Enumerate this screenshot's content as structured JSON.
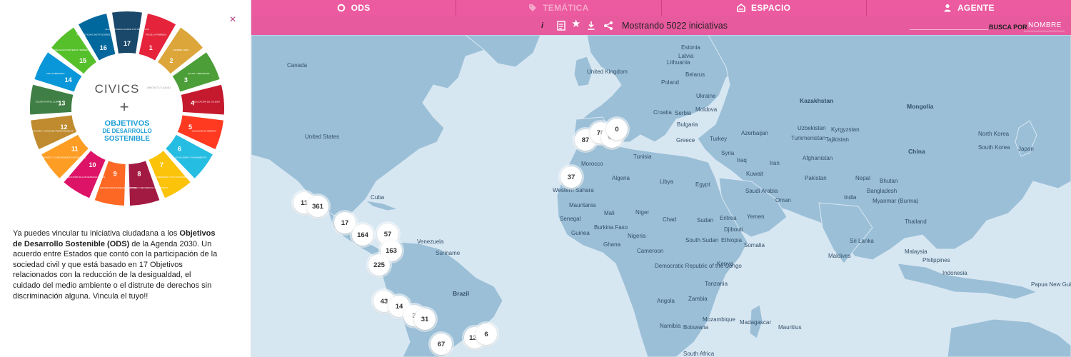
{
  "left_panel": {
    "close_label": "×",
    "wheel": {
      "brand": "CIVICS",
      "tagline": "INNOVA TU CIUDAD",
      "plus": "+",
      "title_line1": "OBJETIVOS",
      "title_line2": "DE DESARROLLO",
      "title_line3": "SOSTENIBLE",
      "colors": [
        "#e5243b",
        "#dda63a",
        "#4c9f38",
        "#c5192d",
        "#ff3a21",
        "#26bde2",
        "#fcc30b",
        "#a21942",
        "#fd6925",
        "#dd1367",
        "#fd9d24",
        "#bf8b2e",
        "#3f7e44",
        "#0a97d9",
        "#56c02b",
        "#00689d",
        "#19486a"
      ],
      "goals": [
        {
          "num": "1",
          "label": "FIN DE LA POBREZA"
        },
        {
          "num": "2",
          "label": "HAMBRE CERO"
        },
        {
          "num": "3",
          "label": "SALUD Y BIENESTAR"
        },
        {
          "num": "4",
          "label": "EDUCACIÓN DE CALIDAD"
        },
        {
          "num": "5",
          "label": "IGUALDAD DE GÉNERO"
        },
        {
          "num": "6",
          "label": "AGUA LIMPIA Y SANEAMIENTO"
        },
        {
          "num": "7",
          "label": "ENERGÍA ASEQUIBLE Y NO CONTAMINANTE"
        },
        {
          "num": "8",
          "label": "TRABAJO DECENTE Y CRECIMIENTO ECONÓMICO"
        },
        {
          "num": "9",
          "label": "INDUSTRIA, INNOVACIÓN E INFRAESTRUCTURA"
        },
        {
          "num": "10",
          "label": "REDUCCIÓN DE LAS DESIGUALDADES"
        },
        {
          "num": "11",
          "label": "CIUDADES Y COMUNIDADES SOSTENIBLES"
        },
        {
          "num": "12",
          "label": "PRODUCCIÓN Y CONSUMO RESPONSABLES"
        },
        {
          "num": "13",
          "label": "ACCIÓN POR EL CLIMA"
        },
        {
          "num": "14",
          "label": "VIDA SUBMARINA"
        },
        {
          "num": "15",
          "label": "VIDA DE ECOSISTEMAS TERRESTRES"
        },
        {
          "num": "16",
          "label": "PAZ, JUSTICIA E INSTITUCIONES SÓLIDAS"
        },
        {
          "num": "17",
          "label": "ALIANZAS PARA LOGRAR LOS OBJETIVOS"
        }
      ]
    },
    "intro": {
      "part1": "Ya puedes vincular tu iniciativa ciudadana a los ",
      "bold": "Objetivos de Desarrollo Sostenible (ODS)",
      "part2": " de la Agenda 2030. Un acuerdo entre Estados que contó con la participación de la sociedad civil y que está basado en 17 Objetivos relacionados con la reducción de la desigualdad, el cuidado del medio ambiente o el distrute de derechos sin discriminación alguna. Vincula el tuyo!!"
    }
  },
  "nav": {
    "tabs": [
      {
        "label": "ODS",
        "icon": "circle-icon"
      },
      {
        "label": "TEMÁTICA",
        "icon": "tag-icon"
      },
      {
        "label": "ESPACIO",
        "icon": "building-icon"
      },
      {
        "label": "AGENTE",
        "icon": "person-icon"
      }
    ]
  },
  "toolbar": {
    "info": "i",
    "star": "★",
    "showing": "Mostrando 5022 iniciativas",
    "search_label": "BUSCA POR",
    "search_value": "",
    "sort_value": "NOMBRE"
  },
  "map": {
    "labels": {
      "canada": "Canada",
      "united_states": "United States",
      "cuba": "Cuba",
      "venezuela": "Venezuela",
      "suriname": "Suriname",
      "brazil": "Brazil",
      "morocco": "Morocco",
      "tunisia": "Tunisia",
      "algeria": "Algeria",
      "western_sahara": "Western Sahara",
      "mauritania": "Mauritania",
      "mali": "Mali",
      "niger": "Niger",
      "senegal": "Senegal",
      "guinea": "Guinea",
      "burkina_faso": "Burkina Faso",
      "nigeria": "Nigeria",
      "ghana": "Ghana",
      "cameroon": "Cameroon",
      "libya": "Libya",
      "egypt": "Egypt",
      "chad": "Chad",
      "sudan": "Sudan",
      "eritrea": "Eritrea",
      "djibouti": "Djibouti",
      "ethiopia": "Ethiopia",
      "south_sudan": "South Sudan",
      "somalia": "Somalia",
      "kenya": "Kenya",
      "tanzania": "Tanzania",
      "drc": "Democratic Republic of the Congo",
      "angola": "Angola",
      "zambia": "Zambia",
      "namibia": "Namibia",
      "botswana": "Botswana",
      "mozambique": "Mozambique",
      "madagascar": "Madagascar",
      "mauritius": "Mauritius",
      "south_africa": "South Africa",
      "estonia": "Estonia",
      "latvia": "Latvia",
      "lithuania": "Lithuania",
      "united_kingdom": "United Kingdom",
      "belarus": "Belarus",
      "poland": "Poland",
      "ukraine": "Ukraine",
      "moldova": "Moldova",
      "croatia": "Croatia",
      "serbia": "Serbia",
      "bulgaria": "Bulgaria",
      "greece": "Greece",
      "turkey": "Turkey",
      "syria": "Syria",
      "iraq": "Iraq",
      "kuwait": "Kuwait",
      "iran": "Iran",
      "saudi_arabia": "Saudi Arabia",
      "oman": "Oman",
      "yemen": "Yemen",
      "kazakhstan": "Kazakhstan",
      "uzbekistan": "Uzbekistan",
      "turkmenistan": "Turkmenistan",
      "azerbaijan": "Azerbaijan",
      "kyrgyzstan": "Kyrgyzstan",
      "tajikistan": "Tajikistan",
      "afghanistan": "Afghanistan",
      "pakistan": "Pakistan",
      "nepal": "Nepal",
      "bhutan": "Bhutan",
      "bangladesh": "Bangladesh",
      "india": "India",
      "myanmar": "Myanmar (Burma)",
      "thailand": "Thailand",
      "sri_lanka": "Sri Lanka",
      "maldives": "Maldives",
      "malaysia": "Malaysia",
      "philippines": "Philippines",
      "indonesia": "Indonesia",
      "papua_new_guinea": "Papua New Guinea",
      "mongolia": "Mongolia",
      "china": "China",
      "north_korea": "North Korea",
      "south_korea": "South Korea",
      "japan": "Japan"
    },
    "markers": [
      {
        "label": "11"
      },
      {
        "label": "361"
      },
      {
        "label": "17"
      },
      {
        "label": "164"
      },
      {
        "label": "57"
      },
      {
        "label": "163"
      },
      {
        "label": "225"
      },
      {
        "label": "43"
      },
      {
        "label": "14"
      },
      {
        "label": "2"
      },
      {
        "label": "31"
      },
      {
        "label": "67"
      },
      {
        "label": "128"
      },
      {
        "label": "6"
      },
      {
        "label": "37"
      },
      {
        "label": "87"
      },
      {
        "label": "70"
      },
      {
        "label": "61"
      },
      {
        "label": "0"
      }
    ]
  }
}
